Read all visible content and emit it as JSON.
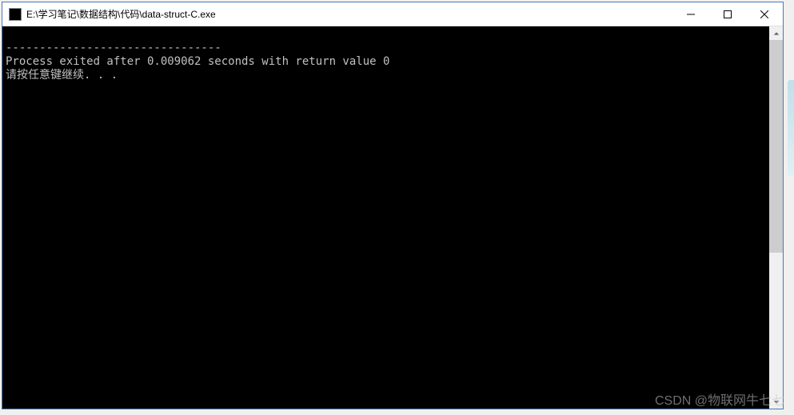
{
  "window": {
    "title": "E:\\学习笔记\\数据结构\\代码\\data-struct-C.exe"
  },
  "console": {
    "blank_line": "",
    "separator": "--------------------------------",
    "exit_line": "Process exited after 0.009062 seconds with return value 0",
    "prompt_line": "请按任意键继续. . ."
  },
  "watermark": "CSDN @物联网牛七七"
}
